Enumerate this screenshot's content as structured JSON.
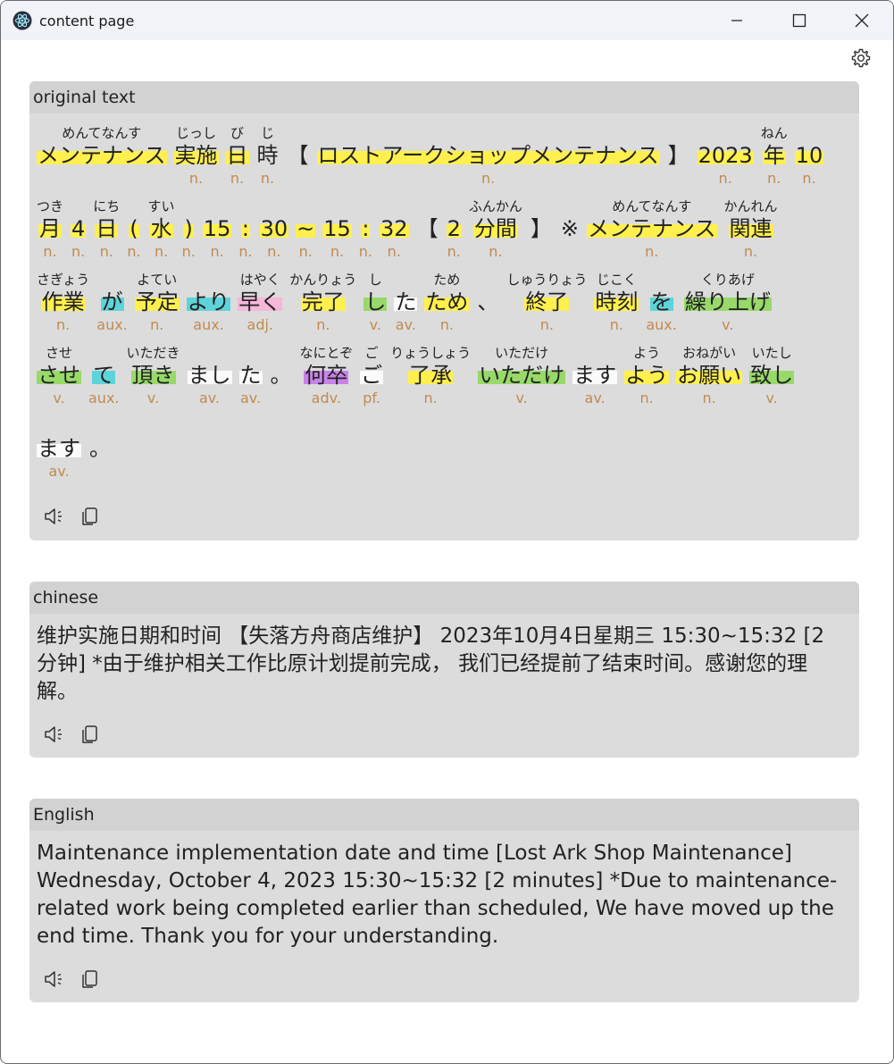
{
  "window": {
    "title": "content page"
  },
  "panels": {
    "original": {
      "label": "original text",
      "lines": [
        [
          {
            "s": "メンテナンス",
            "r": "めんてなんす",
            "p": "",
            "c": "n"
          },
          {
            "s": "実施",
            "r": "じっし",
            "p": "n.",
            "c": "n"
          },
          {
            "s": "日",
            "r": "び",
            "p": "n.",
            "c": "n"
          },
          {
            "s": "時",
            "r": "じ",
            "p": "n.",
            "c": "none"
          },
          {
            "s": "【",
            "r": "",
            "p": "",
            "c": "none"
          },
          {
            "s": "ロストアークショップメンテナンス",
            "r": "",
            "p": "n.",
            "c": "n"
          },
          {
            "s": "】",
            "r": "",
            "p": "",
            "c": "none"
          },
          {
            "s": "2023",
            "r": "",
            "p": "n.",
            "c": "n"
          },
          {
            "s": "年",
            "r": "ねん",
            "p": "n.",
            "c": "n"
          },
          {
            "s": "10",
            "r": "",
            "p": "n.",
            "c": "n"
          }
        ],
        [
          {
            "s": "月",
            "r": "つき",
            "p": "n.",
            "c": "n"
          },
          {
            "s": "4",
            "r": "",
            "p": "n.",
            "c": "n"
          },
          {
            "s": "日",
            "r": "にち",
            "p": "n.",
            "c": "n"
          },
          {
            "s": "(",
            "r": "",
            "p": "n.",
            "c": "n"
          },
          {
            "s": "水",
            "r": "すい",
            "p": "n.",
            "c": "n"
          },
          {
            "s": ")",
            "r": "",
            "p": "n.",
            "c": "n"
          },
          {
            "s": "15",
            "r": "",
            "p": "n.",
            "c": "n"
          },
          {
            "s": ":",
            "r": "",
            "p": "n.",
            "c": "n"
          },
          {
            "s": "30",
            "r": "",
            "p": "n.",
            "c": "n"
          },
          {
            "s": "~",
            "r": "",
            "p": "n.",
            "c": "n"
          },
          {
            "s": "15",
            "r": "",
            "p": "n.",
            "c": "n"
          },
          {
            "s": ":",
            "r": "",
            "p": "n.",
            "c": "n"
          },
          {
            "s": "32",
            "r": "",
            "p": "n.",
            "c": "n"
          },
          {
            "s": "【",
            "r": "",
            "p": "",
            "c": "none"
          },
          {
            "s": "2",
            "r": "",
            "p": "n.",
            "c": "n"
          },
          {
            "s": "分間",
            "r": "ふんかん",
            "p": "n.",
            "c": "n"
          },
          {
            "s": "】",
            "r": "",
            "p": "",
            "c": "none"
          },
          {
            "s": "※",
            "r": "",
            "p": "",
            "c": "none"
          },
          {
            "s": "メンテナンス",
            "r": "めんてなんす",
            "p": "n.",
            "c": "n"
          },
          {
            "s": "関連",
            "r": "かんれん",
            "p": "n.",
            "c": "n"
          }
        ],
        [
          {
            "s": "作業",
            "r": "さぎょう",
            "p": "n.",
            "c": "n"
          },
          {
            "s": "が",
            "r": "",
            "p": "aux.",
            "c": "aux"
          },
          {
            "s": "予定",
            "r": "よてい",
            "p": "n.",
            "c": "n"
          },
          {
            "s": "より",
            "r": "",
            "p": "aux.",
            "c": "aux"
          },
          {
            "s": "早く",
            "r": "はやく",
            "p": "adj.",
            "c": "adj"
          },
          {
            "s": "完了",
            "r": "かんりょう",
            "p": "n.",
            "c": "n"
          },
          {
            "s": "し",
            "r": "し",
            "p": "v.",
            "c": "v"
          },
          {
            "s": "た",
            "r": "",
            "p": "av.",
            "c": "av"
          },
          {
            "s": "ため",
            "r": "ため",
            "p": "n.",
            "c": "n"
          },
          {
            "s": "、",
            "r": "",
            "p": "",
            "c": "none"
          },
          {
            "s": "終了",
            "r": "しゅうりょう",
            "p": "n.",
            "c": "n"
          },
          {
            "s": "時刻",
            "r": "じこく",
            "p": "n.",
            "c": "n"
          },
          {
            "s": "を",
            "r": "",
            "p": "aux.",
            "c": "aux"
          },
          {
            "s": "繰り上げ",
            "r": "くりあげ",
            "p": "v.",
            "c": "v"
          }
        ],
        [
          {
            "s": "させ",
            "r": "させ",
            "p": "v.",
            "c": "v"
          },
          {
            "s": "て",
            "r": "",
            "p": "aux.",
            "c": "aux"
          },
          {
            "s": "頂き",
            "r": "いただき",
            "p": "v.",
            "c": "v"
          },
          {
            "s": "まし",
            "r": "",
            "p": "av.",
            "c": "av"
          },
          {
            "s": "た",
            "r": "",
            "p": "av.",
            "c": "av"
          },
          {
            "s": "。",
            "r": "",
            "p": "",
            "c": "none"
          },
          {
            "s": "何卒",
            "r": "なにとぞ",
            "p": "adv.",
            "c": "adv"
          },
          {
            "s": "ご",
            "r": "ご",
            "p": "pf.",
            "c": "pf"
          },
          {
            "s": "了承",
            "r": "りょうしょう",
            "p": "n.",
            "c": "n"
          },
          {
            "s": "いただけ",
            "r": "いただけ",
            "p": "v.",
            "c": "v"
          },
          {
            "s": "ます",
            "r": "",
            "p": "av.",
            "c": "av"
          },
          {
            "s": "よう",
            "r": "よう",
            "p": "n.",
            "c": "n"
          },
          {
            "s": "お願い",
            "r": "おねがい",
            "p": "n.",
            "c": "n"
          },
          {
            "s": "致し",
            "r": "いたし",
            "p": "v.",
            "c": "v"
          }
        ],
        [
          {
            "s": "ます",
            "r": "",
            "p": "av.",
            "c": "av"
          },
          {
            "s": "。",
            "r": "",
            "p": "",
            "c": "none"
          }
        ]
      ]
    },
    "chinese": {
      "label": "chinese",
      "text": "维护实施日期和时间 【失落方舟商店维护】 2023年10月4日星期三 15:30~15:32 [2分钟] *由于维护相关工作比原计划提前完成， 我们已经提前了结束时间。感谢您的理解。"
    },
    "english": {
      "label": "English",
      "text": "Maintenance implementation date and time [Lost Ark Shop Maintenance] Wednesday, October 4, 2023 15:30~15:32 [2 minutes] *Due to maintenance-related work being completed earlier than scheduled, We have moved up the end time. Thank you for your understanding."
    }
  },
  "icons": {
    "speak": "speaker-icon",
    "copy": "copy-icon",
    "settings": "gear-icon"
  }
}
